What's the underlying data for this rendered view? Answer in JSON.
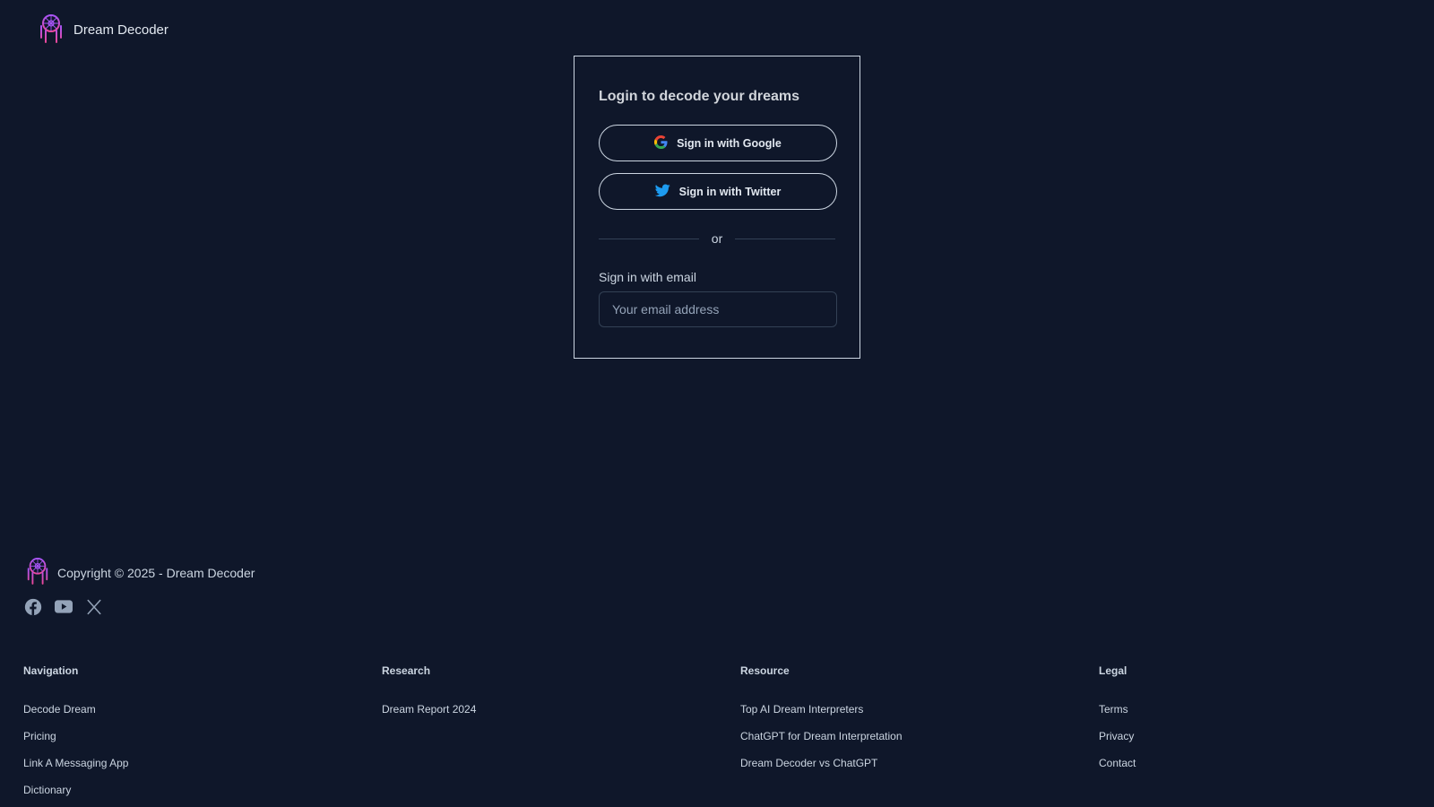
{
  "header": {
    "brand_name": "Dream Decoder"
  },
  "login": {
    "title": "Login to decode your dreams",
    "google_label": "Sign in with Google",
    "twitter_label": "Sign in with Twitter",
    "divider_text": "or",
    "email_label": "Sign in with email",
    "email_placeholder": "Your email address",
    "email_value": ""
  },
  "footer": {
    "copyright": "Copyright © 2025 - Dream Decoder",
    "socials": [
      "facebook-icon",
      "youtube-icon",
      "x-icon"
    ],
    "columns": {
      "navigation": {
        "title": "Navigation",
        "links": [
          "Decode Dream",
          "Pricing",
          "Link A Messaging App",
          "Dictionary"
        ]
      },
      "research": {
        "title": "Research",
        "links": [
          "Dream Report 2024"
        ]
      },
      "resource": {
        "title": "Resource",
        "links": [
          "Top AI Dream Interpreters",
          "ChatGPT for Dream Interpretation",
          "Dream Decoder vs ChatGPT"
        ]
      },
      "legal": {
        "title": "Legal",
        "links": [
          "Terms",
          "Privacy",
          "Contact"
        ]
      }
    }
  },
  "colors": {
    "background": "#0f172a",
    "card_border": "#cbd5e1",
    "logo_purple": "#a855f7",
    "logo_pink": "#ec4899",
    "twitter_blue": "#1d9bf0"
  }
}
